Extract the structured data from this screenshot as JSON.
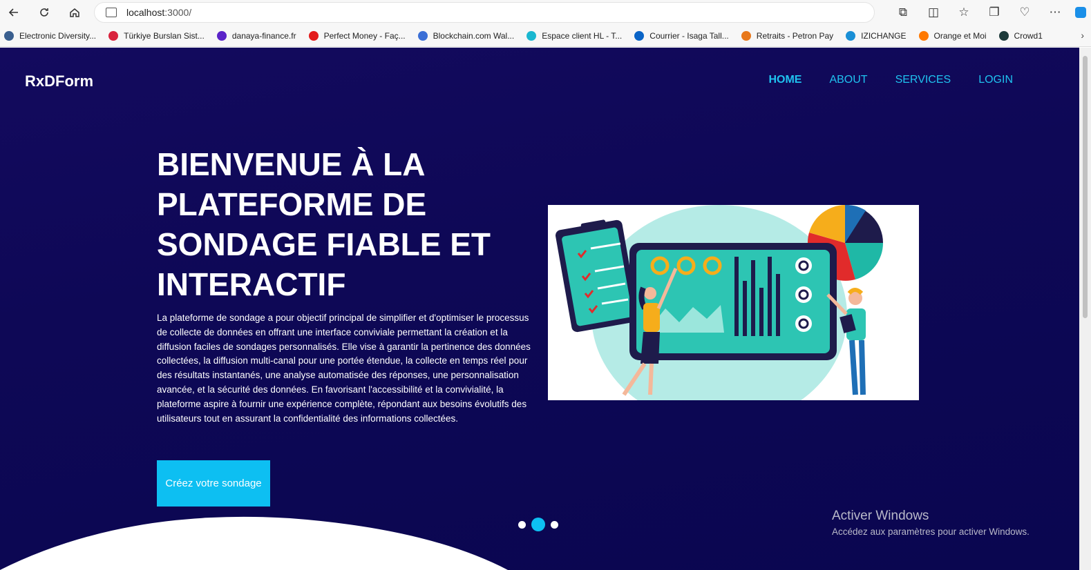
{
  "browser": {
    "url_host": "localhost",
    "url_rest": ":3000/",
    "bookmarks": [
      {
        "label": "Electronic Diversity...",
        "color": "#3a5f8f"
      },
      {
        "label": "Türkiye Burslan Sist...",
        "color": "#d9233d"
      },
      {
        "label": "danaya-finance.fr",
        "color": "#5a23c8"
      },
      {
        "label": "Perfect Money - Faç...",
        "color": "#e31b1b"
      },
      {
        "label": "Blockchain.com Wal...",
        "color": "#3b6fd6"
      },
      {
        "label": "Espace client HL - T...",
        "color": "#1ab7d0"
      },
      {
        "label": "Courrier - Isaga Tall...",
        "color": "#0a64c7"
      },
      {
        "label": "Retraits - Petron Pay",
        "color": "#e8781b"
      },
      {
        "label": "IZICHANGE",
        "color": "#1a8fd6"
      },
      {
        "label": "Orange et Moi",
        "color": "#ff7900"
      },
      {
        "label": "Crowd1",
        "color": "#1e3b3b"
      }
    ]
  },
  "site": {
    "logo": "RxDForm",
    "nav": [
      "HOME",
      "ABOUT",
      "SERVICES",
      "LOGIN"
    ],
    "hero_title": "BIENVENUE À LA PLATEFORME DE SONDAGE FIABLE ET INTERACTIF",
    "hero_text": "La plateforme de sondage a pour objectif principal de simplifier et d'optimiser le processus de collecte de données en offrant une interface conviviale permettant la création et la diffusion faciles de sondages personnalisés. Elle vise à garantir la pertinence des données collectées, la diffusion multi-canal pour une portée étendue, la collecte en temps réel pour des résultats instantanés, une analyse automatisée des réponses, une personnalisation avancée, et la sécurité des données. En favorisant l'accessibilité et la convivialité, la plateforme aspire à fournir une expérience complète, répondant aux besoins évolutifs des utilisateurs tout en assurant la confidentialité des informations collectées.",
    "cta_label": "Créez votre sondage",
    "slider_active_index": 1
  },
  "watermark": {
    "title": "Activer Windows",
    "subtitle": "Accédez aux paramètres pour activer Windows."
  },
  "colors": {
    "accent": "#0dbff2",
    "background": "#0e0856"
  }
}
